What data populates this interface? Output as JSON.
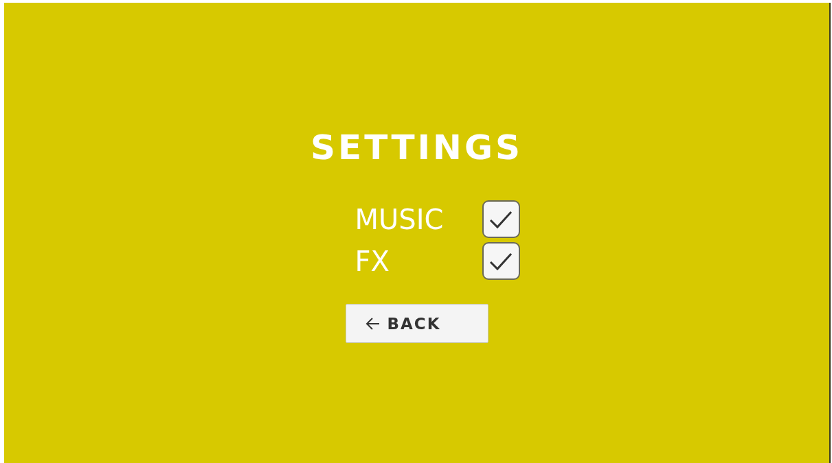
{
  "title": "SETTINGS",
  "options": [
    {
      "label": "MUSIC",
      "checked": true
    },
    {
      "label": "FX",
      "checked": true
    }
  ],
  "back_button": {
    "label": "BACK"
  }
}
